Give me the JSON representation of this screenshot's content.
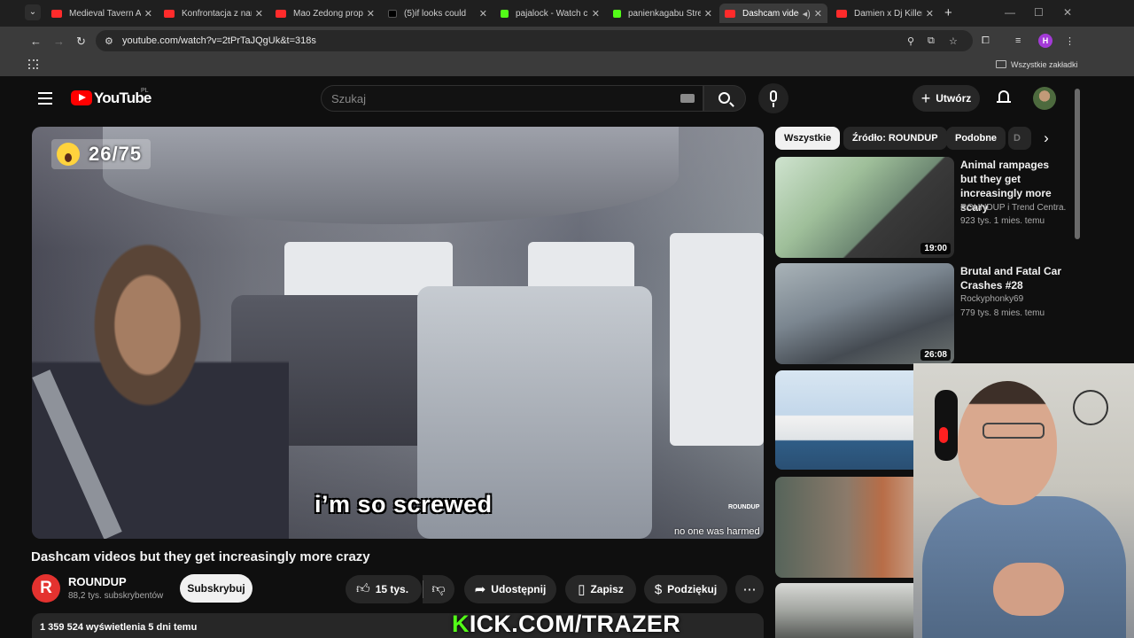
{
  "browser": {
    "tabs": [
      {
        "label": "Medieval Tavern Ar",
        "icon": "youtube-icon"
      },
      {
        "label": "Konfrontacja z nar",
        "icon": "youtube-icon"
      },
      {
        "label": "Mao Zedong prop",
        "icon": "youtube-icon"
      },
      {
        "label": "(5)if looks could",
        "icon": "tiktok-icon"
      },
      {
        "label": "pajalock - Watch cl",
        "icon": "kick-icon"
      },
      {
        "label": "panienkagabu Stre",
        "icon": "kick-icon"
      },
      {
        "label": "Dashcam video",
        "icon": "youtube-icon",
        "active": true
      },
      {
        "label": "Damien x Dj Killer",
        "icon": "youtube-icon"
      }
    ],
    "url": "youtube.com/watch?v=2tPrTaJQgUk&t=318s",
    "profile_initial": "H",
    "bookmarks_label": "Wszystkie zakładki"
  },
  "youtube": {
    "logo_text": "YouTube",
    "country": "PL",
    "search_placeholder": "Szukaj",
    "create_label": "Utwórz"
  },
  "video": {
    "counter_badge": "26/75",
    "caption": "i’m so screwed",
    "corner_note": "no one was harmed",
    "watermark": "ROUNDUP",
    "title": "Dashcam videos but they get increasingly more crazy",
    "channel": {
      "initial": "R",
      "name": "ROUNDUP",
      "subscribers": "88,2 tys. subskrybentów"
    },
    "subscribe_label": "Subskrybuj",
    "likes": "15 tys.",
    "share_label": "Udostępnij",
    "save_label": "Zapisz",
    "thanks_label": "Podziękuj",
    "stats": "1 359 524 wyświetlenia  5 dni temu"
  },
  "chips": [
    "Wszystkie",
    "Źródło: ROUNDUP",
    "Podobne",
    "D"
  ],
  "recommended": [
    {
      "title": "Animal rampages but they get increasingly more scary",
      "channel": "ROUNDUP i Trend Centra...",
      "meta": "923 tys.   1 mies. temu",
      "duration": "19:00"
    },
    {
      "title": "Brutal and Fatal Car Crashes #28",
      "channel": "Rockyphonky69",
      "meta": "779 tys.   8 mies. temu",
      "duration": "26:08"
    }
  ],
  "overlay": {
    "kick_k": "K",
    "kick_rest": "ICK.COM/TRAZER"
  },
  "colors": {
    "youtube_red": "#ff0000",
    "kick_green": "#53fc18",
    "page_bg": "#0f0f0f"
  }
}
